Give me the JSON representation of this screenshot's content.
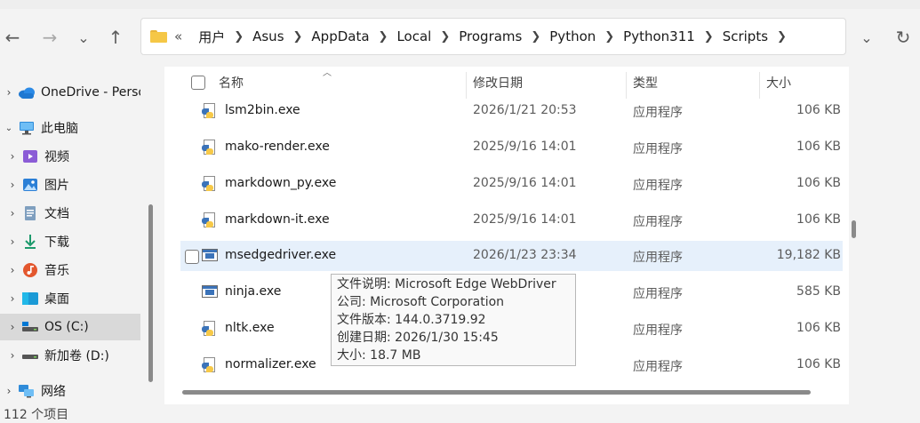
{
  "window": {
    "breadcrumb": [
      "用户",
      "Asus",
      "AppData",
      "Local",
      "Programs",
      "Python",
      "Python311",
      "Scripts"
    ],
    "overflow_marker": "«"
  },
  "nav": {
    "back": "←",
    "forward": "→",
    "recent": "⌄",
    "up": "↑",
    "dropdown": "⌄",
    "refresh": "↻"
  },
  "sidebar": {
    "items": [
      {
        "label": "OneDrive - Personal",
        "icon": "cloud-icon"
      },
      {
        "label": "此电脑",
        "icon": "computer-icon"
      },
      {
        "label": "视频",
        "icon": "video-icon"
      },
      {
        "label": "图片",
        "icon": "picture-icon"
      },
      {
        "label": "文档",
        "icon": "document-icon"
      },
      {
        "label": "下载",
        "icon": "download-icon"
      },
      {
        "label": "音乐",
        "icon": "music-icon"
      },
      {
        "label": "桌面",
        "icon": "desktop-icon"
      },
      {
        "label": "OS (C:)",
        "icon": "drive-icon"
      },
      {
        "label": "新加卷 (D:)",
        "icon": "drive-icon"
      },
      {
        "label": "网络",
        "icon": "network-icon"
      }
    ]
  },
  "columns": {
    "name": "名称",
    "date": "修改日期",
    "type": "类型",
    "size": "大小"
  },
  "files": [
    {
      "name": "lsm2bin.exe",
      "date": "2026/1/21 20:53",
      "type": "应用程序",
      "size": "106 KB",
      "icon": "python-exe-icon"
    },
    {
      "name": "mako-render.exe",
      "date": "2025/9/16 14:01",
      "type": "应用程序",
      "size": "106 KB",
      "icon": "python-exe-icon"
    },
    {
      "name": "markdown_py.exe",
      "date": "2025/9/16 14:01",
      "type": "应用程序",
      "size": "106 KB",
      "icon": "python-exe-icon"
    },
    {
      "name": "markdown-it.exe",
      "date": "2025/9/16 14:01",
      "type": "应用程序",
      "size": "106 KB",
      "icon": "python-exe-icon"
    },
    {
      "name": "msedgedriver.exe",
      "date": "2026/1/23 23:34",
      "type": "应用程序",
      "size": "19,182 KB",
      "icon": "exe-icon"
    },
    {
      "name": "ninja.exe",
      "date": "",
      "type": "应用程序",
      "size": "585 KB",
      "icon": "exe-icon"
    },
    {
      "name": "nltk.exe",
      "date": "",
      "type": "应用程序",
      "size": "106 KB",
      "icon": "python-exe-icon"
    },
    {
      "name": "normalizer.exe",
      "date": "",
      "type": "应用程序",
      "size": "106 KB",
      "icon": "python-exe-icon"
    }
  ],
  "tooltip": {
    "line1": "文件说明: Microsoft Edge WebDriver",
    "line2": "公司: Microsoft Corporation",
    "line3": "文件版本: 144.0.3719.92",
    "line4": "创建日期: 2026/1/30 15:45",
    "line5": "大小: 18.7 MB"
  },
  "status": {
    "item_count": "112 个项目"
  }
}
